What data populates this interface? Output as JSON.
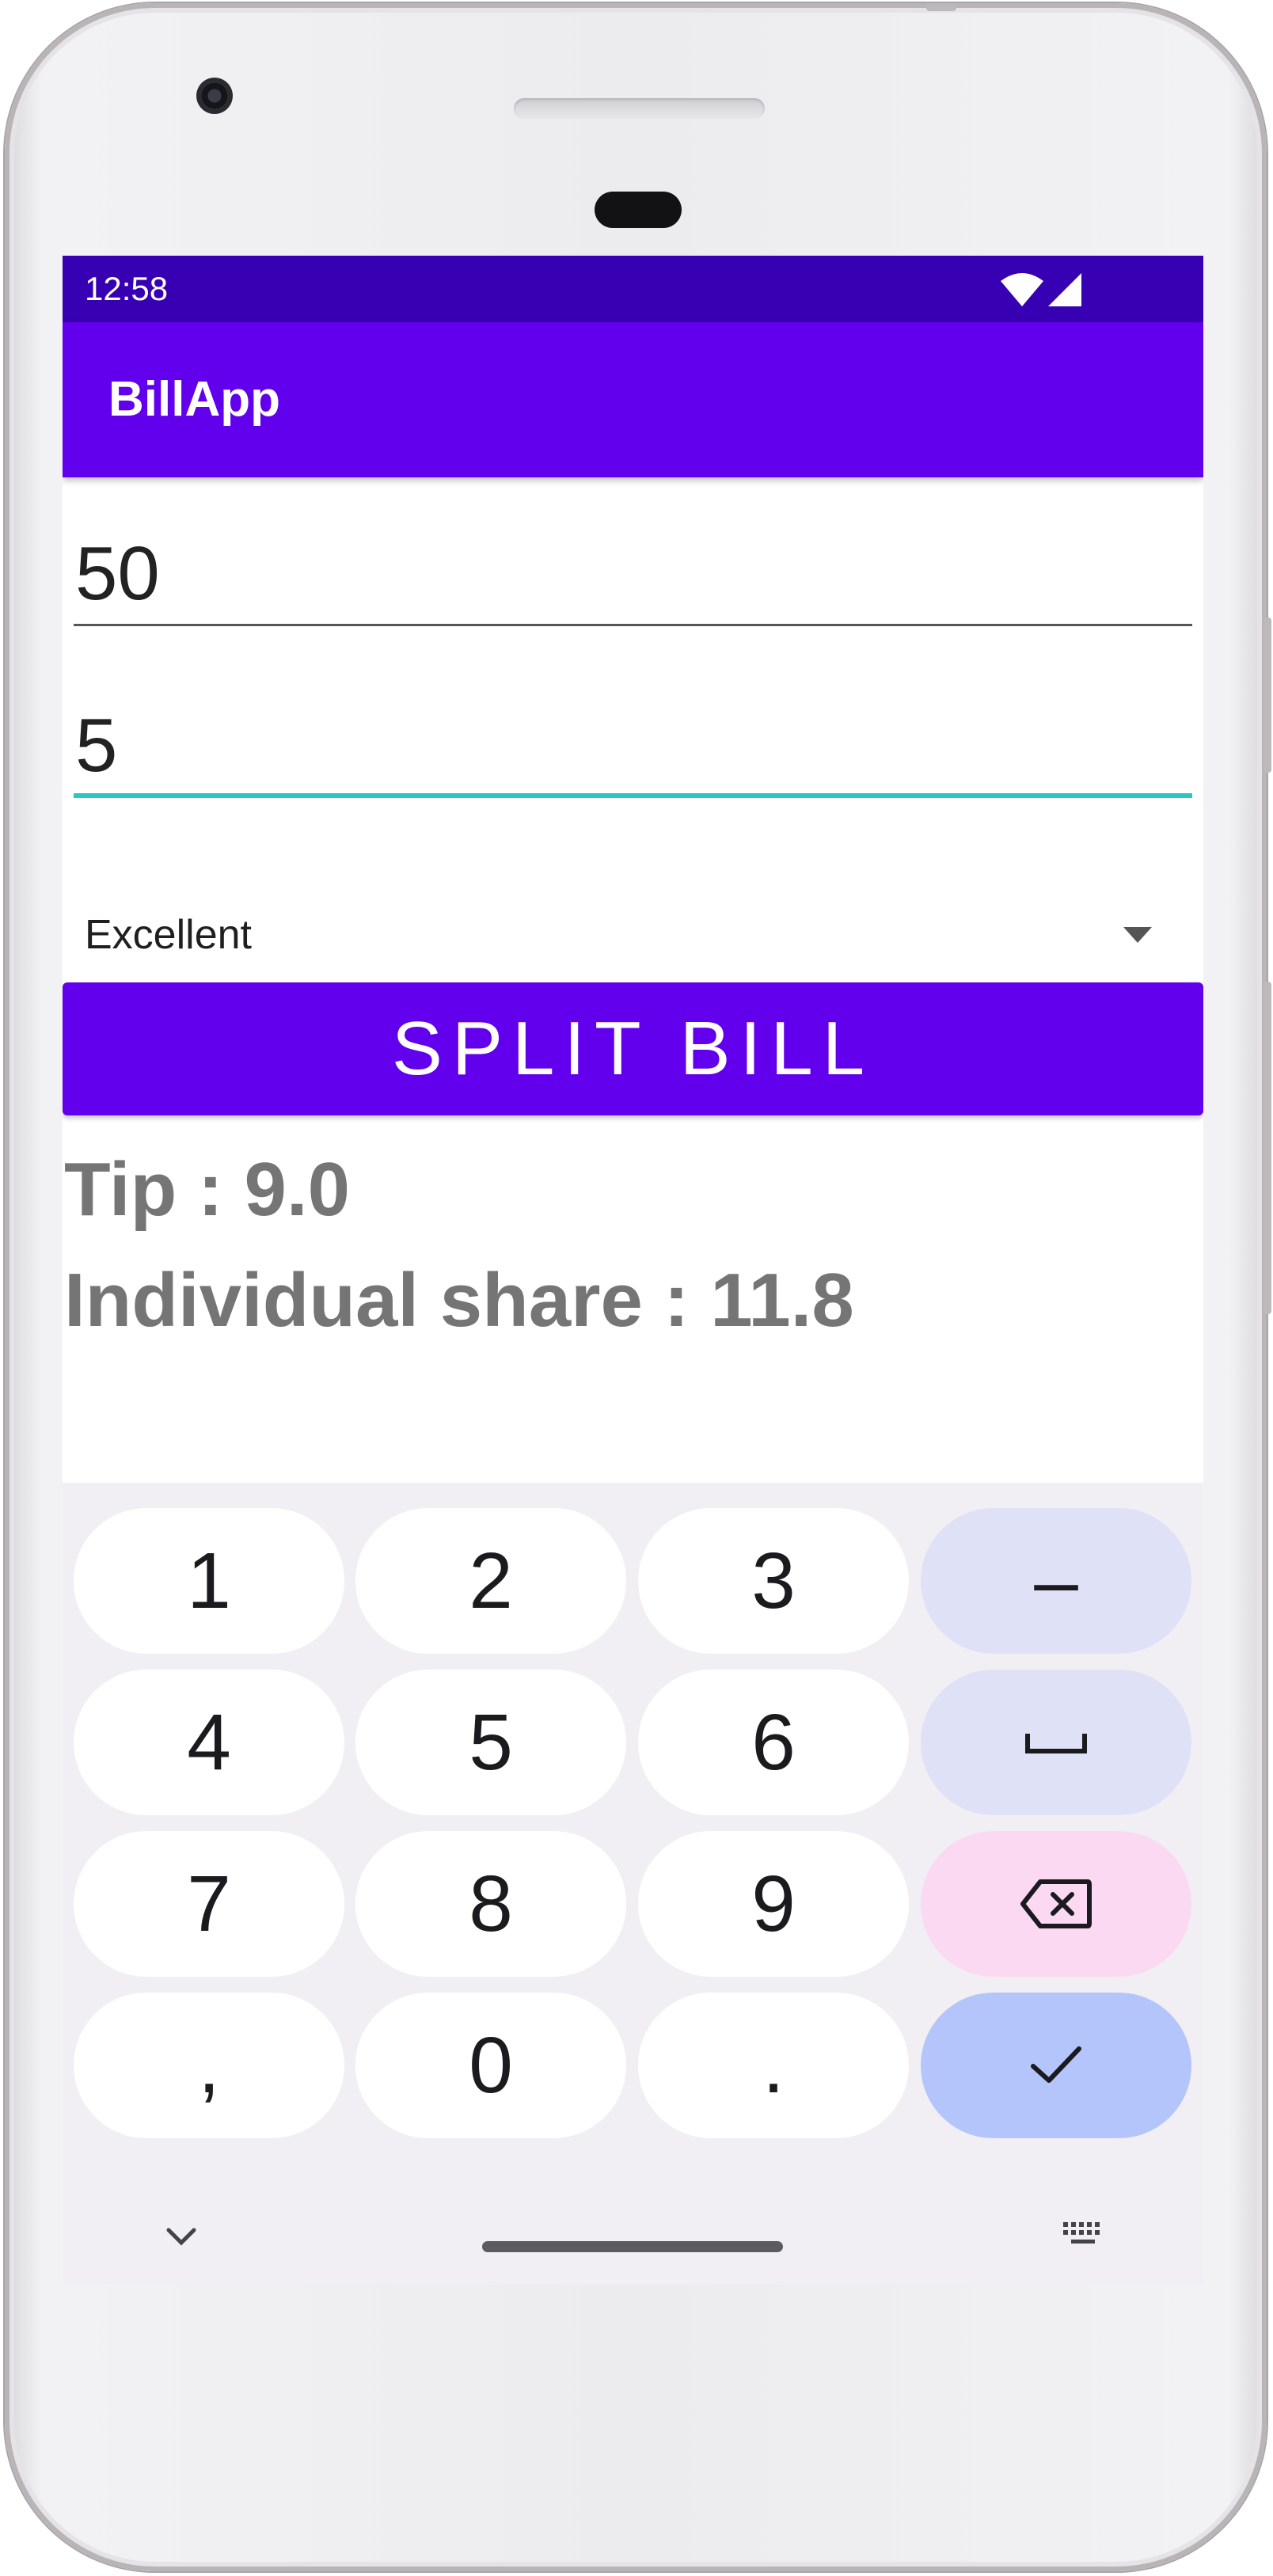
{
  "status_bar": {
    "time": "12:58",
    "icons": [
      "wifi-icon",
      "cell-signal-icon"
    ]
  },
  "app_bar": {
    "title": "BillApp",
    "color": "#6200ee"
  },
  "form": {
    "bill_amount": "50",
    "people_count": "5",
    "service_rating": "Excellent"
  },
  "split_button": {
    "label": "SPLIT BILL"
  },
  "results": {
    "tip": "Tip : 9.0",
    "individual_share": "Individual share : 11.8"
  },
  "keyboard": {
    "rows": [
      [
        "1",
        "2",
        "3",
        "–"
      ],
      [
        "4",
        "5",
        "6",
        "␣"
      ],
      [
        "7",
        "8",
        "9",
        "⌫"
      ],
      [
        ",",
        "0",
        ".",
        "✓"
      ]
    ],
    "nav_icons": [
      "chevron-down-icon",
      "keyboard-icon"
    ]
  },
  "colors": {
    "status_bar": "#3700b3",
    "primary": "#6200ee",
    "accent_underline": "#2ac7c2"
  }
}
